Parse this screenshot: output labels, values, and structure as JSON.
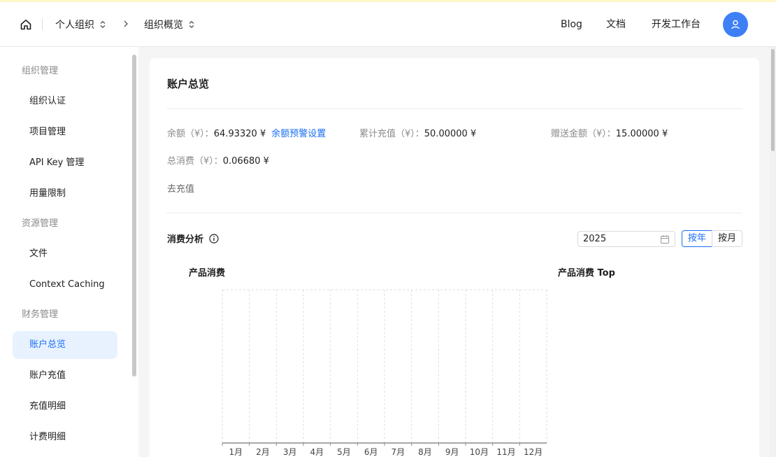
{
  "header": {
    "breadcrumb": [
      "个人组织",
      "组织概览"
    ],
    "nav": [
      "Blog",
      "文档",
      "开发工作台"
    ]
  },
  "sidebar": {
    "groups": [
      {
        "label": "组织管理",
        "items": [
          "组织认证",
          "项目管理",
          "API Key 管理",
          "用量限制"
        ]
      },
      {
        "label": "资源管理",
        "items": [
          "文件",
          "Context Caching"
        ]
      },
      {
        "label": "财务管理",
        "items": [
          "账户总览",
          "账户充值",
          "充值明细",
          "计费明细"
        ]
      }
    ],
    "active": "账户总览"
  },
  "account": {
    "title": "账户总览",
    "balance_label": "余额（¥）：",
    "balance_value": "64.93320 ¥",
    "balance_alert_link": "余额预警设置",
    "recharge_total_label": "累计充值（¥）：",
    "recharge_total_value": "50.00000 ¥",
    "gift_label": "赠送金额（¥）：",
    "gift_value": "15.00000 ¥",
    "spend_label": "总消费（¥）：",
    "spend_value": "0.06680 ¥",
    "recharge_link": "去充值"
  },
  "analysis": {
    "title": "消费分析",
    "year_value": "2025",
    "by_year": "按年",
    "by_month": "按月",
    "product_spend_title": "产品消费",
    "product_top_title": "产品消费 Top"
  },
  "chart_data": {
    "type": "bar",
    "categories": [
      "1月",
      "2月",
      "3月",
      "4月",
      "5月",
      "6月",
      "7月",
      "8月",
      "9月",
      "10月",
      "11月",
      "12月"
    ],
    "values": [
      0,
      0,
      0,
      0,
      0,
      0,
      0,
      0,
      0,
      0,
      0,
      0
    ],
    "title": "产品消费",
    "grid": true
  },
  "colors": {
    "accent": "#1a6ef5",
    "avatar": "#3d7ff5",
    "active_bg": "#e8f2ff"
  }
}
